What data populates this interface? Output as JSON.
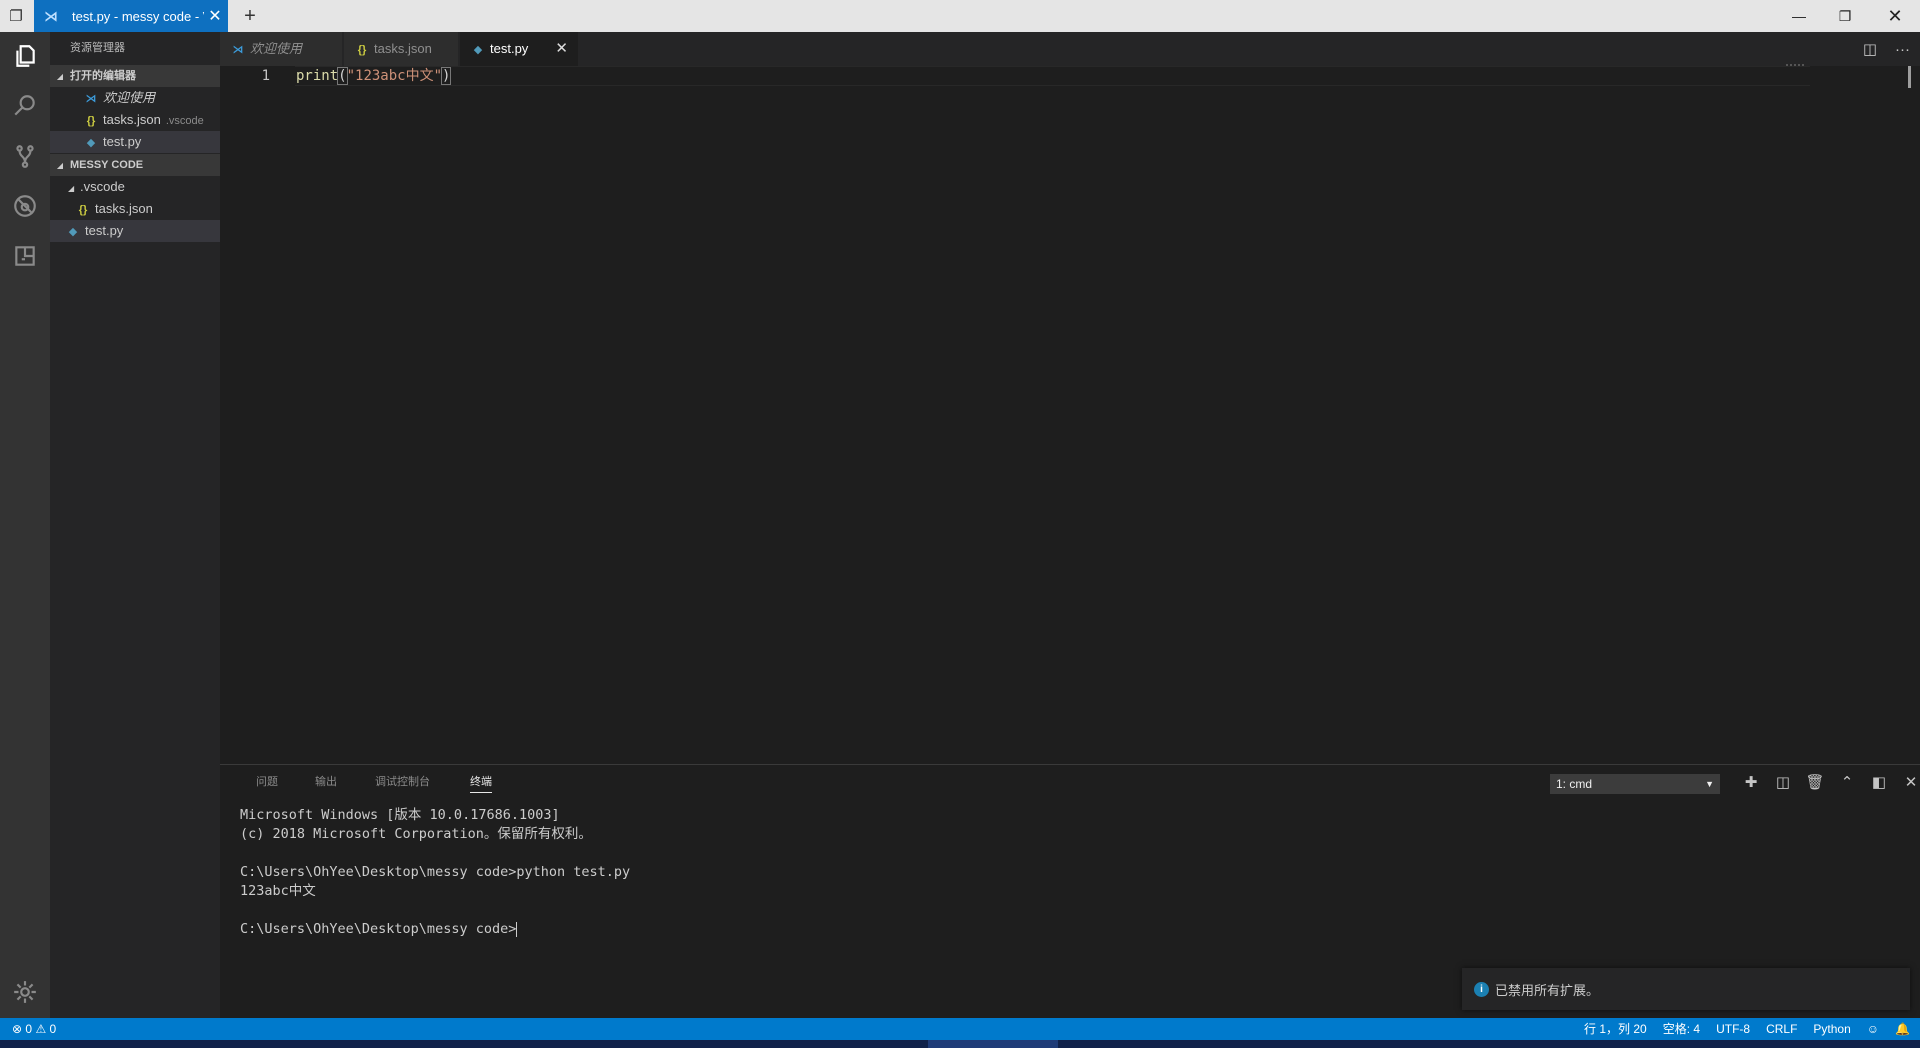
{
  "titlebar": {
    "tab_title": "test.py - messy code - Visual Studio Code",
    "new_tab": "+",
    "close": "✕"
  },
  "activity": {
    "icons": [
      "explorer-icon",
      "search-icon",
      "source-control-icon",
      "debug-icon",
      "extensions-icon",
      "gear-icon"
    ]
  },
  "sidebar": {
    "title": "资源管理器",
    "open_editors_label": "打开的编辑器",
    "open_editors": [
      {
        "label": "欢迎使用",
        "desc": ""
      },
      {
        "label": "tasks.json",
        "desc": ".vscode"
      },
      {
        "label": "test.py",
        "desc": ""
      }
    ],
    "folder_label": "MESSY CODE",
    "tree": [
      {
        "label": ".vscode"
      },
      {
        "label": "tasks.json"
      },
      {
        "label": "test.py"
      }
    ]
  },
  "tabs": [
    {
      "label": "欢迎使用"
    },
    {
      "label": "tasks.json"
    },
    {
      "label": "test.py",
      "close": "✕"
    }
  ],
  "editor": {
    "line_number": "1",
    "code": {
      "fn": "print",
      "open": "(",
      "str": "\"123abc中文\"",
      "close": ")"
    }
  },
  "panel": {
    "tabs": [
      "问题",
      "输出",
      "调试控制台",
      "终端"
    ],
    "active_tab": "终端",
    "terminal_select": "1: cmd",
    "terminal_lines": [
      "Microsoft Windows [版本 10.0.17686.1003]",
      "(c) 2018 Microsoft Corporation。保留所有权利。",
      "",
      "C:\\Users\\OhYee\\Desktop\\messy code>python test.py",
      "123abc中文",
      "",
      "C:\\Users\\OhYee\\Desktop\\messy code>"
    ]
  },
  "notification": {
    "message": "已禁用所有扩展。"
  },
  "status": {
    "errors": "0",
    "warnings": "0",
    "position": "行 1，列 20",
    "indent": "空格: 4",
    "encoding": "UTF-8",
    "eol": "CRLF",
    "language": "Python"
  },
  "colors": {
    "accent": "#007acc",
    "title_tab": "#0e70c0",
    "editor_bg": "#1e1e1e",
    "sidebar_bg": "#252526",
    "activity_bg": "#333333"
  }
}
